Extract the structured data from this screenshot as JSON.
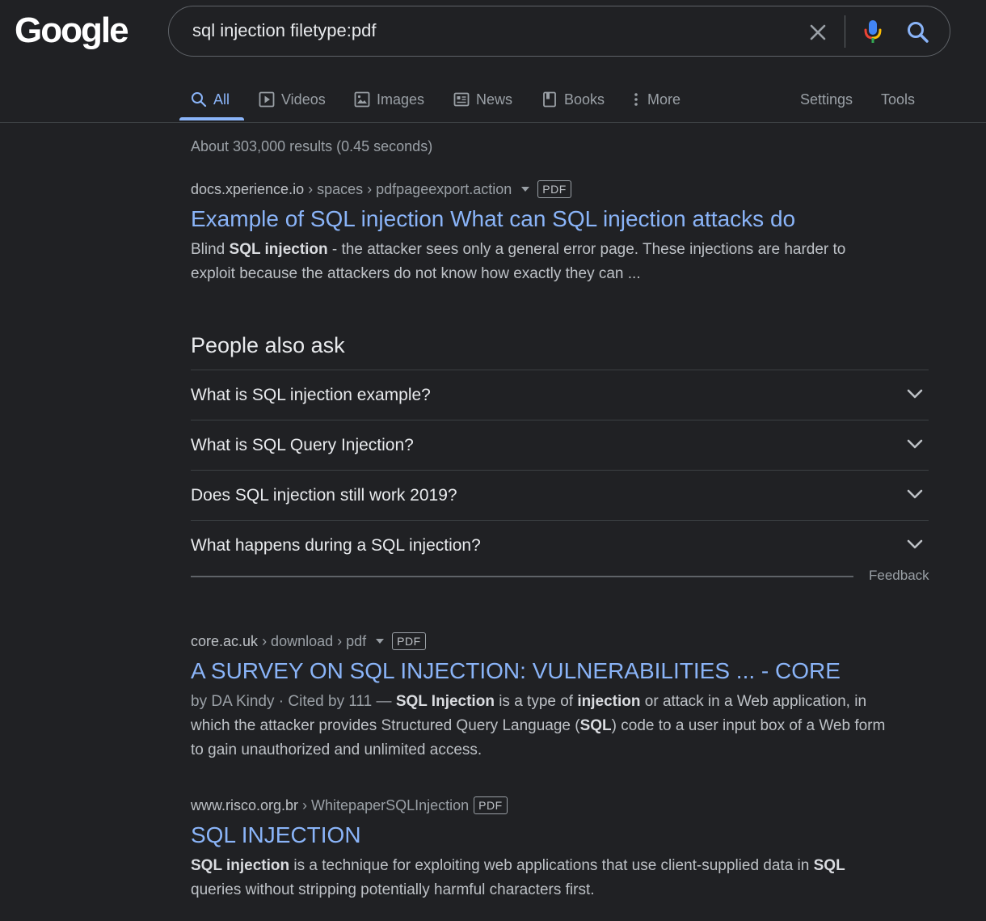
{
  "logo": {
    "text": "Google"
  },
  "search": {
    "query": "sql injection filetype:pdf",
    "clear_icon": "close-icon",
    "mic_icon": "mic-icon",
    "search_icon": "search-icon"
  },
  "tabs": [
    {
      "label": "All",
      "icon": "search-icon",
      "active": true
    },
    {
      "label": "Videos",
      "icon": "play-icon"
    },
    {
      "label": "Images",
      "icon": "image-icon"
    },
    {
      "label": "News",
      "icon": "news-icon"
    },
    {
      "label": "Books",
      "icon": "book-icon"
    },
    {
      "label": "More",
      "icon": "more-vert-icon"
    }
  ],
  "settings_label": "Settings",
  "tools_label": "Tools",
  "stats": "About 303,000 results (0.45 seconds)",
  "results": [
    {
      "host": "docs.xperience.io",
      "path": "› spaces › pdfpageexport.action",
      "badge": "PDF",
      "title": "Example of SQL injection What can SQL injection attacks do",
      "snippet": [
        {
          "t": "Blind "
        },
        {
          "t": "SQL injection",
          "b": true
        },
        {
          "t": " - the attacker sees only a general error page. These injections are harder to exploit because the attackers do not know how exactly they can ..."
        }
      ]
    },
    {
      "host": "core.ac.uk",
      "path": "› download › pdf",
      "badge": "PDF",
      "title": "A SURVEY ON SQL INJECTION: VULNERABILITIES ... - CORE",
      "meta": "by DA Kindy · Cited by 111 — ",
      "snippet": [
        {
          "t": "SQL Injection",
          "b": true
        },
        {
          "t": " is a type of "
        },
        {
          "t": "injection",
          "b": true
        },
        {
          "t": " or attack in a Web application, in which the attacker provides Structured Query Language ("
        },
        {
          "t": "SQL",
          "b": true
        },
        {
          "t": ") code to a user input box of a Web form to gain unauthorized and unlimited access."
        }
      ]
    },
    {
      "host": "www.risco.org.br",
      "path": "› WhitepaperSQLInjection",
      "badge": "PDF",
      "title": "SQL INJECTION",
      "snippet": [
        {
          "t": "SQL injection",
          "b": true
        },
        {
          "t": " is a technique for exploiting web applications that use client-supplied data in "
        },
        {
          "t": "SQL",
          "b": true
        },
        {
          "t": " queries without stripping potentially harmful characters first."
        }
      ]
    }
  ],
  "people_also_ask": {
    "heading": "People also ask",
    "questions": [
      "What is SQL injection example?",
      "What is SQL Query Injection?",
      "Does SQL injection still work 2019?",
      "What happens during a SQL injection?"
    ],
    "feedback": "Feedback"
  },
  "colors": {
    "background": "#202124",
    "link": "#8ab4f8",
    "text": "#bdc1c6",
    "muted": "#9aa0a6",
    "mic_blue": "#4285f4",
    "mic_red": "#ea4335",
    "mic_yellow": "#fbbc04",
    "mic_green": "#34a853"
  }
}
